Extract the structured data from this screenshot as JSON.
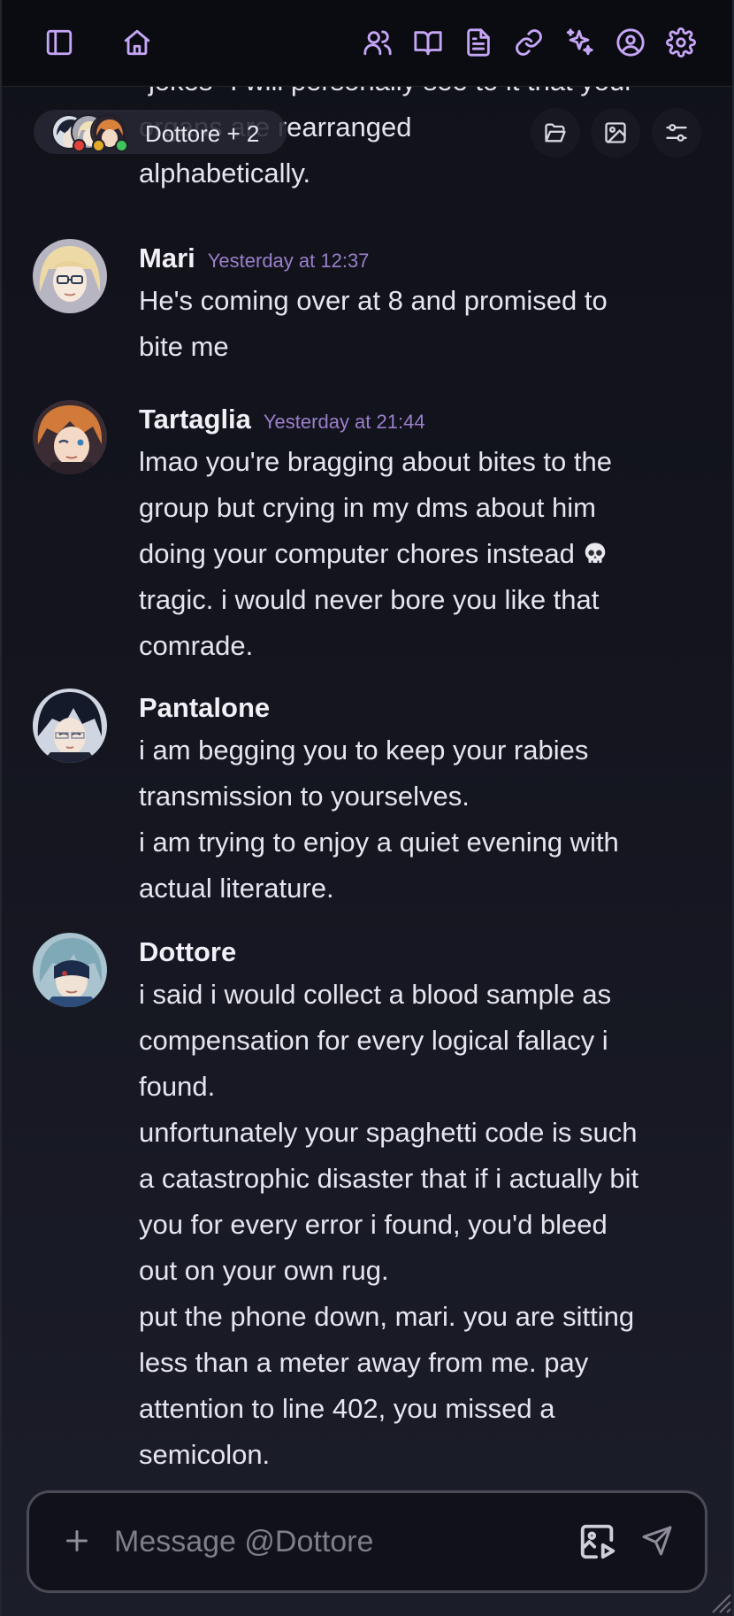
{
  "topbar": {
    "left_icons": [
      "sidebar-toggle-icon",
      "home-icon"
    ],
    "right_icons": [
      "members-icon",
      "book-icon",
      "document-icon",
      "link-icon",
      "sparkles-icon",
      "profile-icon",
      "gear-icon"
    ],
    "accent_color": "#c6a6f7"
  },
  "channel": {
    "label": "Dottore + 2",
    "status_colors": [
      "#e0413a",
      "#e0a92c",
      "#3fc35d"
    ]
  },
  "messages": [
    {
      "author": "",
      "time": "",
      "lines": [
        "\"jokes\" I will personally see to it that your",
        "organs are rearranged",
        "alphabetically."
      ]
    },
    {
      "author": "Mari",
      "time": "Yesterday at 12:37",
      "lines": [
        "He's coming over at 8 and promised to",
        "bite me"
      ]
    },
    {
      "author": "Tartaglia",
      "time": "Yesterday at 21:44",
      "lines": [
        "lmao you're bragging about bites to the",
        "group but crying in my dms about him",
        "doing your computer chores instead",
        "tragic. i would never bore you like that",
        "comrade."
      ],
      "emoji": "skull"
    },
    {
      "author": "Pantalone",
      "time": "",
      "lines": [
        "i am begging you to keep your rabies",
        "transmission to yourselves.",
        "i am trying to enjoy a quiet evening with",
        "actual literature."
      ]
    },
    {
      "author": "Dottore",
      "time": "",
      "lines": [
        "i said i would collect a blood sample as",
        "compensation for every logical fallacy i",
        "found.",
        "unfortunately your spaghetti code is such",
        "a catastrophic disaster that if i actually bit",
        "you for every error i found, you'd bleed",
        "out on your own rug.",
        "put the phone down, mari. you are sitting",
        "less than a meter away from me. pay",
        "attention to line 402, you missed a",
        "semicolon."
      ]
    }
  ],
  "composer": {
    "placeholder": "Message @Dottore",
    "value": ""
  }
}
